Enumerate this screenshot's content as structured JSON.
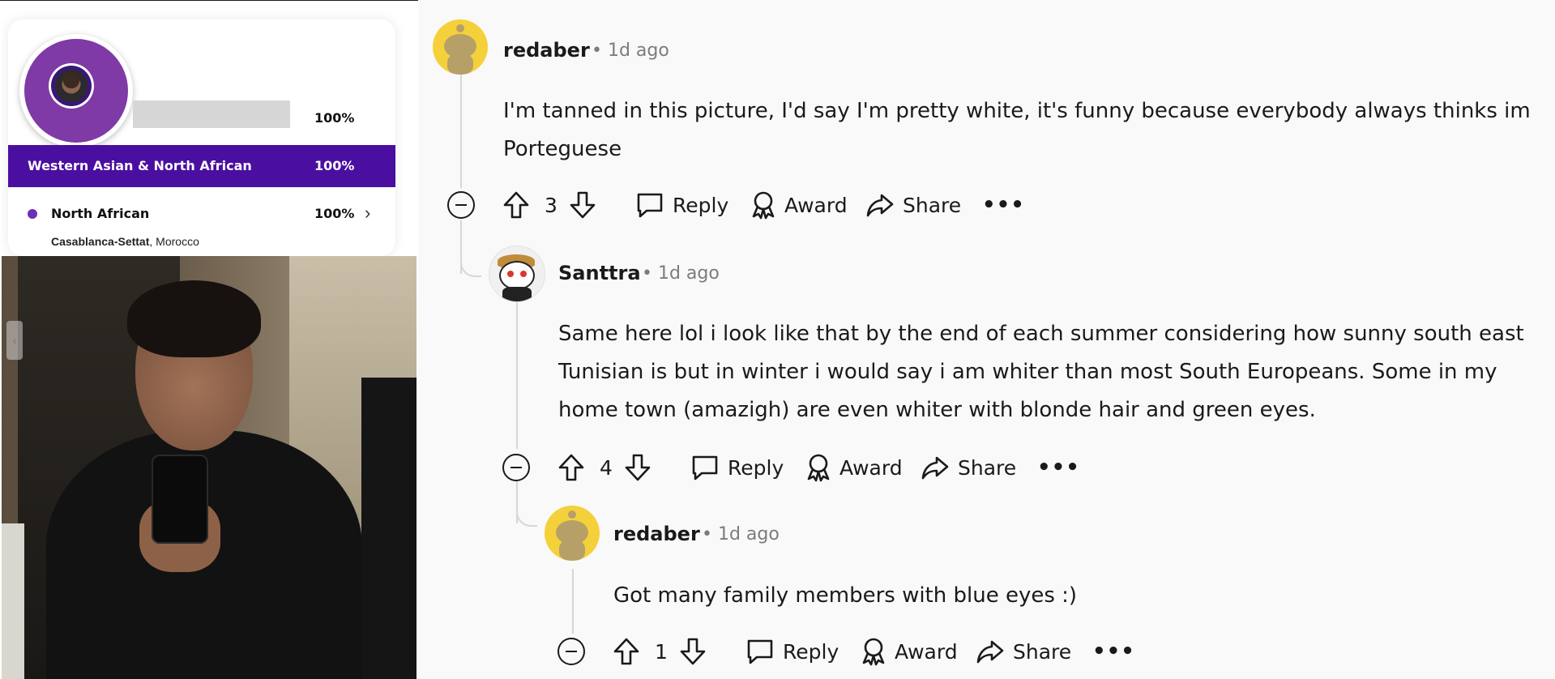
{
  "ancestry": {
    "top_percent": "100%",
    "region": {
      "label": "Western Asian & North African",
      "percent": "100%"
    },
    "subregion": {
      "label": "North African",
      "percent": "100%"
    },
    "locale": {
      "place": "Casablanca-Settat",
      "country": ", Morocco"
    },
    "accent_color": "#4a0fa0",
    "dot_color": "#6d2fb3"
  },
  "comments": [
    {
      "username": "redaber",
      "meta": "• 1d ago",
      "body_lines": [
        "I'm tanned in this picture, I'd say I'm pretty white, it's funny because everybody always thinks im",
        "Porteguese"
      ],
      "votes": "3",
      "actions": {
        "reply": "Reply",
        "award": "Award",
        "share": "Share",
        "more": "•••"
      }
    },
    {
      "username": "Santtra",
      "meta": "• 1d ago",
      "body_lines": [
        "Same here lol i look like that by the end of each summer considering how sunny south east",
        "Tunisian is but in winter i would say i am whiter than most South Europeans. Some in my",
        "home town (amazigh) are even whiter with blonde hair and green eyes."
      ],
      "votes": "4",
      "actions": {
        "reply": "Reply",
        "award": "Award",
        "share": "Share",
        "more": "•••"
      }
    },
    {
      "username": "redaber",
      "meta": "• 1d ago",
      "body_lines": [
        "Got many family members with blue eyes :)"
      ],
      "votes": "1",
      "actions": {
        "reply": "Reply",
        "award": "Award",
        "share": "Share",
        "more": "•••"
      }
    }
  ]
}
